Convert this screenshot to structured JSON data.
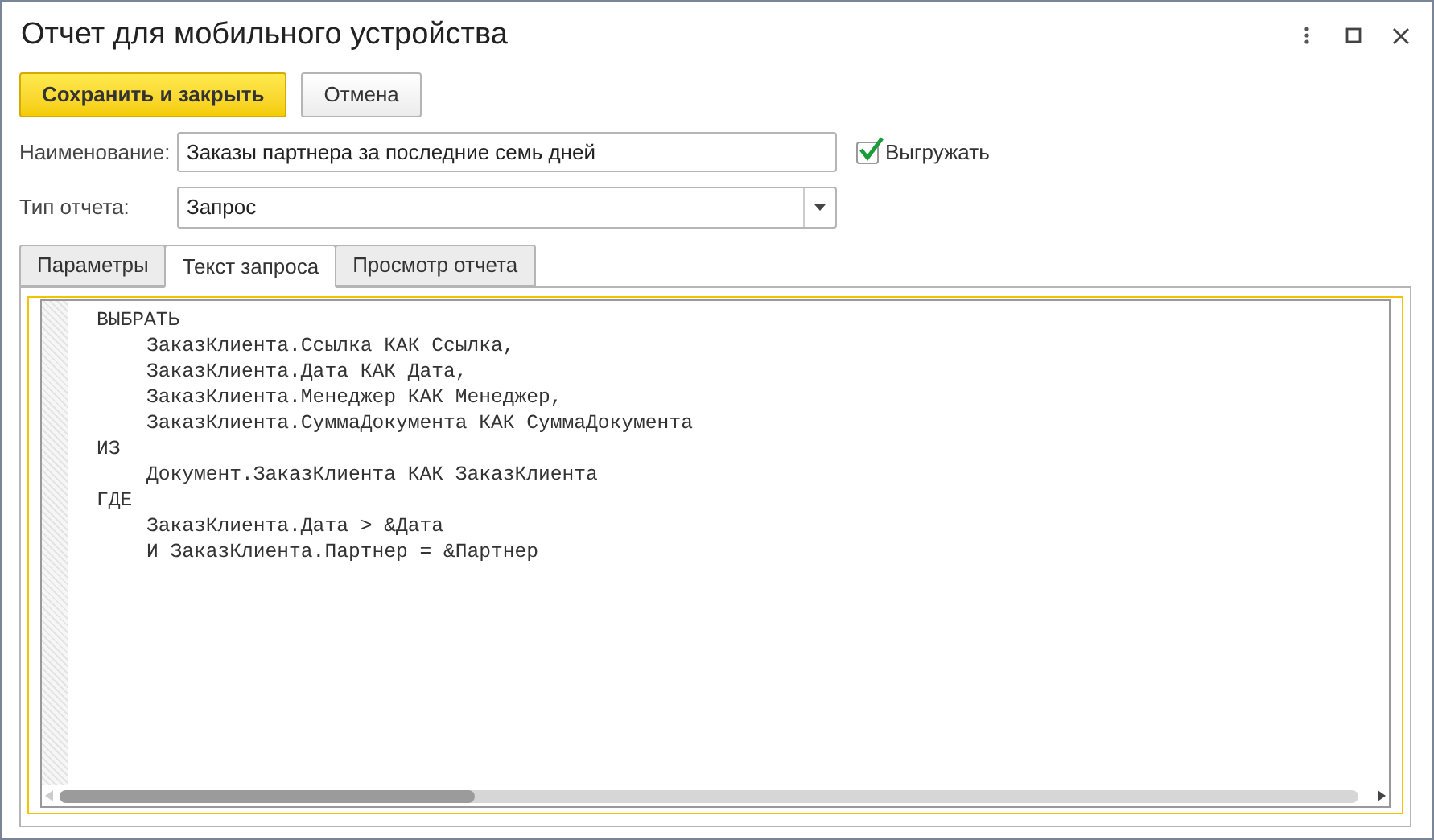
{
  "window": {
    "title": "Отчет для мобильного устройства"
  },
  "buttons": [
    {
      "label": "Сохранить и закрыть",
      "kind": "primary"
    },
    {
      "label": "Отмена",
      "kind": "normal"
    }
  ],
  "name_field": {
    "label": "Наименование:",
    "value": "Заказы партнера за последние семь дней"
  },
  "export_checkbox": {
    "label": "Выгружать",
    "checked": true
  },
  "type_field": {
    "label": "Тип отчета:",
    "value": "Запрос"
  },
  "tabs": [
    {
      "label": "Параметры",
      "selected": false
    },
    {
      "label": "Текст запроса",
      "selected": true
    },
    {
      "label": "Просмотр отчета",
      "selected": false
    }
  ],
  "query_text": [
    {
      "text": "ВЫБРАТЬ",
      "children": [
        {
          "text": "ЗаказКлиента.Ссылка КАК Ссылка,"
        },
        {
          "text": "ЗаказКлиента.Дата КАК Дата,"
        },
        {
          "text": "ЗаказКлиента.Менеджер КАК Менеджер,"
        },
        {
          "text": "ЗаказКлиента.СуммаДокумента КАК СуммаДокумента"
        }
      ]
    },
    {
      "text": "ИЗ",
      "children": [
        {
          "text": "Документ.ЗаказКлиента КАК ЗаказКлиента"
        }
      ]
    },
    {
      "text": "ГДЕ",
      "children": [
        {
          "text": "ЗаказКлиента.Дата > &Дата"
        },
        {
          "text": "И ЗаказКлиента.Партнер = &Партнер"
        }
      ]
    }
  ]
}
